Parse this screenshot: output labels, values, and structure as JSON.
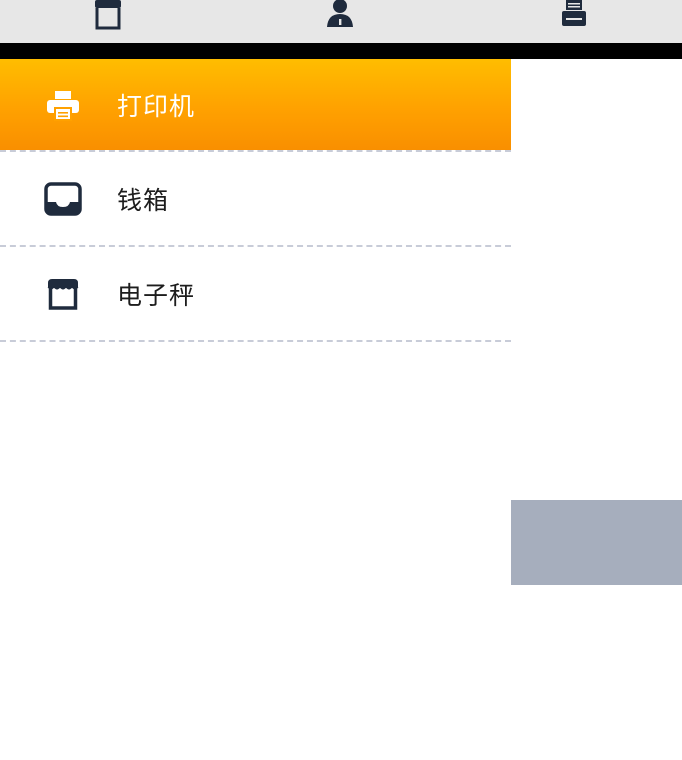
{
  "tabs": [
    {
      "icon": "store-icon"
    },
    {
      "icon": "user-icon"
    },
    {
      "icon": "printer-icon"
    }
  ],
  "menu": {
    "items": [
      {
        "label": "打印机",
        "icon": "printer-icon",
        "active": true
      },
      {
        "label": "钱箱",
        "icon": "inbox-tray-icon",
        "active": false
      },
      {
        "label": "电子秤",
        "icon": "store-icon",
        "active": false
      }
    ]
  },
  "colors": {
    "topbar": "#e7e7e7",
    "active_gradient_top": "#ffbd00",
    "active_gradient_bottom": "#f98f00",
    "icon_dark": "#1f2b3d",
    "divider": "#c8ccd8",
    "grey_block": "#a6aebd"
  }
}
